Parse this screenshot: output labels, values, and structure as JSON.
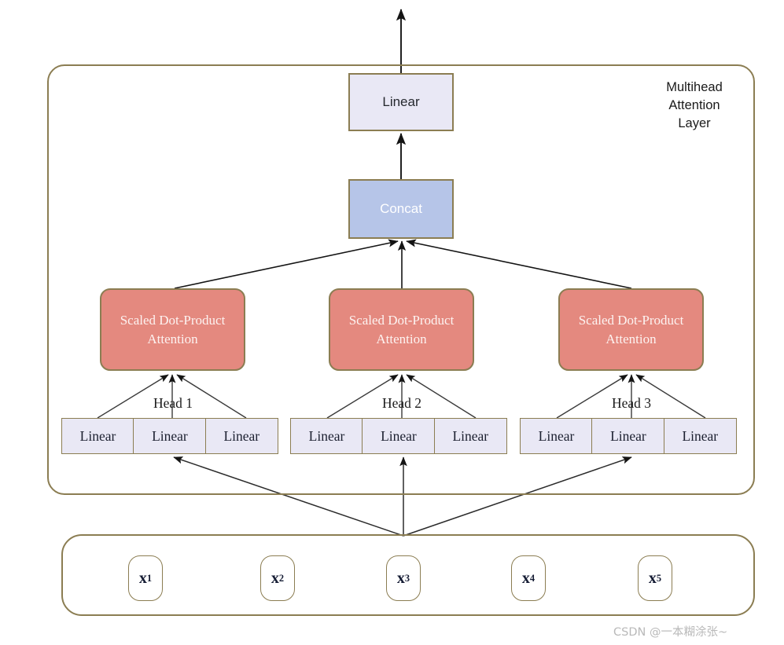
{
  "diagram": {
    "title_caption": "Multihead\nAttention\nLayer",
    "caption_lines": [
      "Multihead",
      "Attention",
      "Layer"
    ],
    "colors": {
      "container_border": "#8b7d52",
      "linear_fill": "#e9e8f5",
      "concat_fill": "#b6c5e8",
      "attention_fill": "#e4897f",
      "edge": "#1a1a1a",
      "background": "#ffffff",
      "watermark_text": "#b9b9b9"
    },
    "output": {
      "label": "",
      "arrow": "output-arrow-up"
    },
    "linear_top": {
      "label": "Linear"
    },
    "concat": {
      "label": "Concat"
    },
    "heads": [
      {
        "head_label": "Head 1",
        "attention_label_line1": "Scaled Dot-Product",
        "attention_label_line2": "Attention",
        "linears": [
          "Linear",
          "Linear",
          "Linear"
        ]
      },
      {
        "head_label": "Head 2",
        "attention_label_line1": "Scaled Dot-Product",
        "attention_label_line2": "Attention",
        "linears": [
          "Linear",
          "Linear",
          "Linear"
        ]
      },
      {
        "head_label": "Head 3",
        "attention_label_line1": "Scaled Dot-Product",
        "attention_label_line2": "Attention",
        "linears": [
          "Linear",
          "Linear",
          "Linear"
        ]
      }
    ],
    "inputs": [
      {
        "base": "x",
        "sub": "1"
      },
      {
        "base": "x",
        "sub": "2"
      },
      {
        "base": "x",
        "sub": "3"
      },
      {
        "base": "x",
        "sub": "4"
      },
      {
        "base": "x",
        "sub": "5"
      }
    ],
    "watermark": "CSDN @一本糊涂张~"
  }
}
